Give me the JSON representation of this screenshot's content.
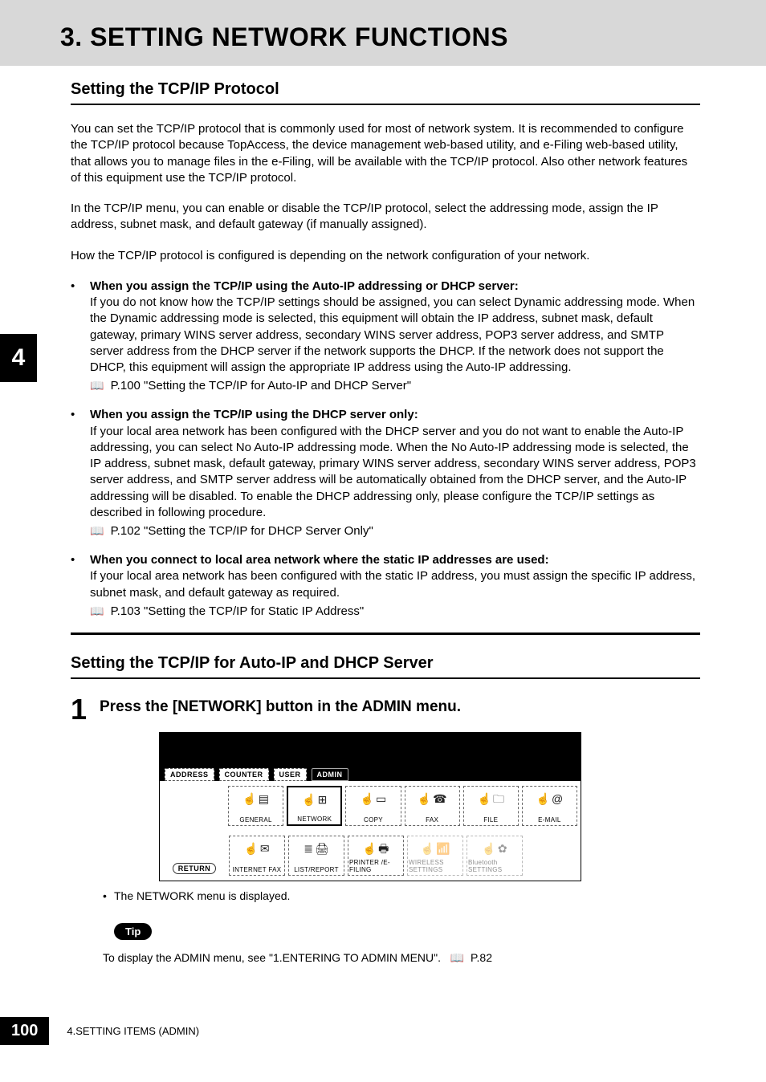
{
  "chapter_tab": "4",
  "page_number": "100",
  "footer": "4.SETTING ITEMS (ADMIN)",
  "header_title": "3. SETTING NETWORK FUNCTIONS",
  "section1": {
    "heading": "Setting the TCP/IP Protocol",
    "p1": "You can set the TCP/IP protocol that is commonly used for most of network system.  It is recommended to configure the TCP/IP protocol because TopAccess, the device management web-based utility, and e-Filing web-based utility, that allows you to manage files in the e-Filing, will be available with the TCP/IP protocol. Also other network features of this equipment use the TCP/IP protocol.",
    "p2": "In the TCP/IP menu, you can enable or disable the TCP/IP protocol, select the addressing mode, assign the IP address, subnet mask, and default gateway (if manually assigned).",
    "p3": "How the TCP/IP protocol is configured is depending on the network configuration of your network.",
    "bullets": [
      {
        "title": "When you assign the TCP/IP using the Auto-IP addressing or DHCP server:",
        "text": "If you do not know how the TCP/IP settings should be assigned, you can select Dynamic addressing mode.  When the Dynamic addressing mode is selected, this equipment will obtain the IP address, subnet mask, default gateway, primary WINS server address, secondary WINS server address, POP3 server address, and SMTP server address from the DHCP server if the network supports the DHCP.  If the network does not support the DHCP, this equipment will assign the appropriate IP address using the Auto-IP addressing.",
        "ref": "P.100 \"Setting the TCP/IP for Auto-IP and DHCP Server\""
      },
      {
        "title": "When you assign the TCP/IP using the DHCP server only:",
        "text": "If your local area network has been configured with the DHCP server and you do not want to enable the Auto-IP addressing, you can select No Auto-IP addressing mode.  When the No Auto-IP addressing mode is selected, the IP address, subnet mask, default gateway, primary WINS server address, secondary WINS server address, POP3 server address, and SMTP server address will be automatically obtained from the DHCP server, and the Auto-IP addressing will be disabled.  To enable the DHCP addressing only, please configure the TCP/IP settings as described in following procedure.",
        "ref": "P.102 \"Setting the TCP/IP for DHCP Server Only\""
      },
      {
        "title": "When you connect to local area network where the static IP addresses are used:",
        "text": "If your local area network has been configured with the static IP address, you must assign the specific IP address, subnet mask, and default gateway as required.",
        "ref": "P.103 \"Setting the TCP/IP for Static IP Address\""
      }
    ]
  },
  "section2": {
    "heading": "Setting the TCP/IP for Auto-IP and DHCP Server",
    "step_num": "1",
    "step_title": "Press the [NETWORK] button in the ADMIN menu.",
    "note": "The NETWORK menu is displayed.",
    "tip_label": "Tip",
    "tip_text": "To display the ADMIN menu, see \"1.ENTERING TO ADMIN MENU\".",
    "tip_ref": "P.82"
  },
  "screenshot": {
    "tabs": [
      "ADDRESS",
      "COUNTER",
      "USER",
      "ADMIN"
    ],
    "active_tab": "ADMIN",
    "return_btn": "RETURN",
    "row1": [
      "GENERAL",
      "NETWORK",
      "COPY",
      "FAX",
      "FILE",
      "E-MAIL"
    ],
    "row2": [
      "INTERNET FAX",
      "LIST/REPORT",
      "PRINTER /E-FILING",
      "WIRELESS SETTINGS",
      "Bluetooth SETTINGS"
    ]
  }
}
